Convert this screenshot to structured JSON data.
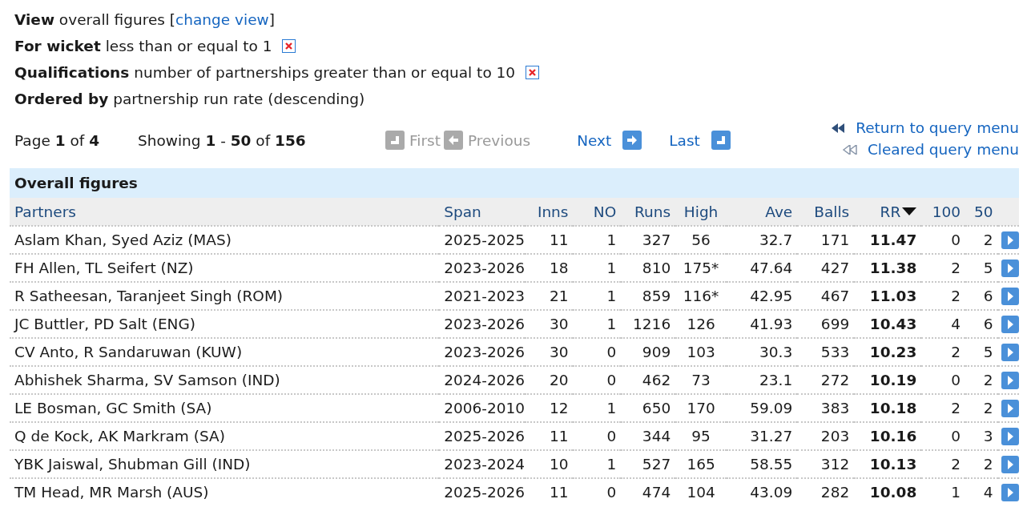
{
  "filters": [
    {
      "label": "View",
      "text": "overall figures",
      "link_open": "[",
      "link": "change view",
      "link_close": "]",
      "removable": false
    },
    {
      "label": "For wicket",
      "text": "less than or equal to 1",
      "removable": true
    },
    {
      "label": "Qualifications",
      "text": "number of partnerships greater than or equal to 10",
      "removable": true
    },
    {
      "label": "Ordered by",
      "text": "partnership run rate (descending)",
      "removable": false
    }
  ],
  "pager": {
    "page": "Page **1** of **4**",
    "showing": "Showing **1** - **50** of **156**",
    "buttons": [
      {
        "label": "First",
        "kind": "first",
        "disabled": true
      },
      {
        "label": "Previous",
        "kind": "prev",
        "disabled": true
      },
      {
        "label": "Next",
        "kind": "next",
        "disabled": false
      },
      {
        "label": "Last",
        "kind": "last",
        "disabled": false
      }
    ],
    "menu_links": [
      {
        "label": "Return to query menu",
        "kind": "return"
      },
      {
        "label": "Cleared query menu",
        "kind": "cleared"
      }
    ]
  },
  "table": {
    "title": "Overall figures",
    "columns": [
      {
        "label": "Partners",
        "sorted": false
      },
      {
        "label": "Span",
        "sorted": false
      },
      {
        "label": "Inns",
        "sorted": false
      },
      {
        "label": "NO",
        "sorted": false
      },
      {
        "label": "Runs",
        "sorted": false
      },
      {
        "label": "High",
        "sorted": false
      },
      {
        "label": "Ave",
        "sorted": false
      },
      {
        "label": "Balls",
        "sorted": false
      },
      {
        "label": "RR",
        "sorted": true
      },
      {
        "label": "100",
        "sorted": false
      },
      {
        "label": "50",
        "sorted": false
      }
    ],
    "rows": [
      [
        "Aslam Khan, Syed Aziz (MAS)",
        "2025-2025",
        "11",
        "1",
        "327",
        "56",
        "32.7",
        "171",
        "11.47",
        "0",
        "2"
      ],
      [
        "FH Allen, TL Seifert (NZ)",
        "2023-2026",
        "18",
        "1",
        "810",
        "175*",
        "47.64",
        "427",
        "11.38",
        "2",
        "5"
      ],
      [
        "R Satheesan, Taranjeet Singh (ROM)",
        "2021-2023",
        "21",
        "1",
        "859",
        "116*",
        "42.95",
        "467",
        "11.03",
        "2",
        "6"
      ],
      [
        "JC Buttler, PD Salt (ENG)",
        "2023-2026",
        "30",
        "1",
        "1216",
        "126",
        "41.93",
        "699",
        "10.43",
        "4",
        "6"
      ],
      [
        "CV Anto, R Sandaruwan (KUW)",
        "2023-2026",
        "30",
        "0",
        "909",
        "103",
        "30.3",
        "533",
        "10.23",
        "2",
        "5"
      ],
      [
        "Abhishek Sharma, SV Samson (IND)",
        "2024-2026",
        "20",
        "0",
        "462",
        "73",
        "23.1",
        "272",
        "10.19",
        "0",
        "2"
      ],
      [
        "LE Bosman, GC Smith (SA)",
        "2006-2010",
        "12",
        "1",
        "650",
        "170",
        "59.09",
        "383",
        "10.18",
        "2",
        "2"
      ],
      [
        "Q de Kock, AK Markram (SA)",
        "2025-2026",
        "11",
        "0",
        "344",
        "95",
        "31.27",
        "203",
        "10.16",
        "0",
        "3"
      ],
      [
        "YBK Jaiswal, Shubman Gill (IND)",
        "2023-2024",
        "10",
        "1",
        "527",
        "165",
        "58.55",
        "312",
        "10.13",
        "2",
        "2"
      ],
      [
        "TM Head, MR Marsh (AUS)",
        "2025-2026",
        "11",
        "0",
        "474",
        "104",
        "43.09",
        "282",
        "10.08",
        "1",
        "4"
      ]
    ]
  }
}
